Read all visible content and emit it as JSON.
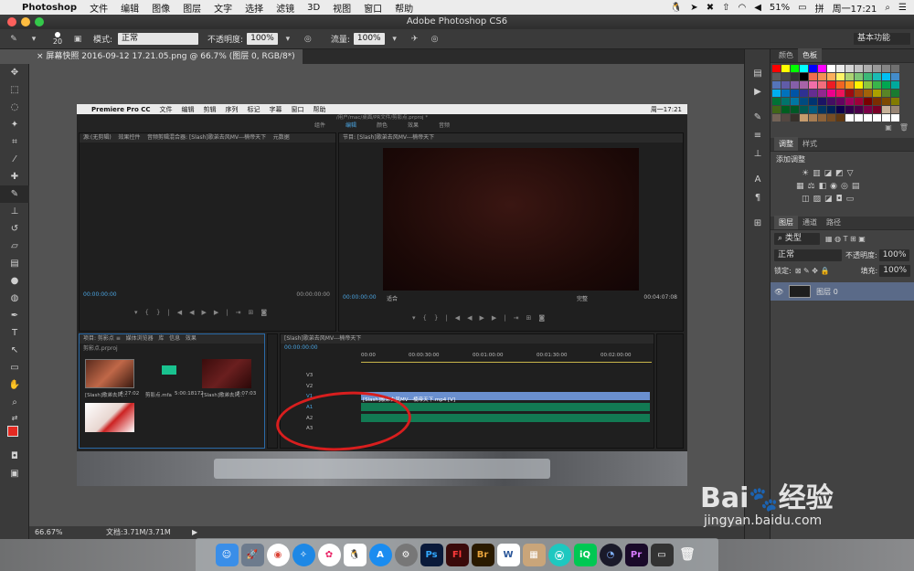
{
  "menubar": {
    "app_name": "Photoshop",
    "items": [
      "文件",
      "编辑",
      "图像",
      "图层",
      "文字",
      "选择",
      "滤镜",
      "3D",
      "视图",
      "窗口",
      "帮助"
    ],
    "battery": "51%",
    "clock": "周一17:21"
  },
  "window": {
    "title": "Adobe Photoshop CS6"
  },
  "options": {
    "brush_size": "20",
    "mode_label": "模式:",
    "mode_value": "正常",
    "opacity_label": "不透明度:",
    "opacity_value": "100%",
    "flow_label": "流量:",
    "flow_value": "100%",
    "workspace": "基本功能"
  },
  "document_tab": {
    "label": "屏幕快照 2016-09-12 17.21.05.png @ 66.7% (图层 0, RGB/8*)",
    "close": "×"
  },
  "status": {
    "zoom": "66.67%",
    "doc_size": "文档:3.71M/3.71M"
  },
  "panels": {
    "color_tabs": [
      "颜色",
      "色板"
    ],
    "adjust_tabs": [
      "调整",
      "样式"
    ],
    "adjust_title": "添加调整",
    "layers_tabs": [
      "图层",
      "通道",
      "路径"
    ],
    "kind_filter": "类型",
    "blend_mode": "正常",
    "opacity_label": "不透明度:",
    "opacity_value": "100%",
    "lock_label": "锁定:",
    "fill_label": "填充:",
    "fill_value": "100%",
    "layer_name": "图层 0"
  },
  "swatch_colors": [
    "#ff0000",
    "#ffff00",
    "#00ff00",
    "#00ffff",
    "#0000ff",
    "#ff00ff",
    "#ffffff",
    "#ebebeb",
    "#d6d6d6",
    "#c2c2c2",
    "#adadad",
    "#999999",
    "#858585",
    "#707070",
    "#5c5c5c",
    "#474747",
    "#333333",
    "#000000",
    "#f26c4f",
    "#f68e55",
    "#fbaf5c",
    "#fff467",
    "#acd372",
    "#7cc576",
    "#3bb878",
    "#1abbb4",
    "#00bff3",
    "#438cca",
    "#5574b9",
    "#605ca8",
    "#855fa8",
    "#a763a8",
    "#f06ea9",
    "#f26d7d",
    "#ed1c24",
    "#f26522",
    "#f7941d",
    "#fff200",
    "#8dc63f",
    "#39b54a",
    "#00a651",
    "#00a99d",
    "#00aeef",
    "#0072bc",
    "#0054a6",
    "#2e3192",
    "#662d91",
    "#92278f",
    "#ec008c",
    "#ed145b",
    "#9e0b0f",
    "#a0410d",
    "#a36209",
    "#aba000",
    "#598527",
    "#1a7b30",
    "#007236",
    "#00746b",
    "#0076a3",
    "#004b80",
    "#003471",
    "#1b1464",
    "#440e62",
    "#630460",
    "#9e005d",
    "#9e0039",
    "#790000",
    "#7b2e00",
    "#7d4900",
    "#827b00",
    "#406618",
    "#005e20",
    "#005826",
    "#005952",
    "#005b7f",
    "#003663",
    "#002157",
    "#0d004c",
    "#32004b",
    "#4b0049",
    "#7b0046",
    "#7a0026",
    "#c7b299",
    "#998675",
    "#736357",
    "#534741",
    "#37302a",
    "#c69c6d",
    "#a67c52",
    "#8c6239",
    "#754c24",
    "#603913",
    "#ffffff",
    "#ffffff",
    "#ffffff",
    "#ffffff",
    "#ffffff",
    "#ffffff"
  ],
  "premiere": {
    "app": "Premiere Pro CC",
    "menus": [
      "文件",
      "编辑",
      "剪辑",
      "序列",
      "标记",
      "字幕",
      "窗口",
      "帮助"
    ],
    "path": "/用户/mac/桌面/PR文件/剪影点.prproj *",
    "workspace_tabs": [
      "组件",
      "编辑",
      "颜色",
      "效果",
      "音频"
    ],
    "source_tabs": [
      "源:(无剪辑)",
      "效果控件",
      "音频剪辑混合器: [Slash]歌弟去风MV---楠帝天下",
      "元数据"
    ],
    "program_tab": "节目: [Slash]歌弟去风MV---楠帝天下",
    "timecode_zero": "00:00:00:00",
    "program_timecode": "00:00:00:00",
    "program_duration": "00:04:07:08",
    "fit": "适合",
    "quality": "完整",
    "project_tabs": [
      "项目: 剪影点 ≡",
      "媒体浏览器",
      "库",
      "信息",
      "效果",
      "标"
    ],
    "project_file": "剪影点.prproj",
    "timeline_tab": "[Slash]歌弟去风MV---楠帝天下",
    "timeline_ticks": [
      "00:00",
      "00:00:30:00",
      "00:01:00:00",
      "00:01:30:00",
      "00:02:00:00"
    ],
    "tracks": [
      "V3",
      "V2",
      "V1",
      "A1",
      "A2",
      "A3"
    ],
    "clip_label": "[Slash]歌弟去风MV---楠帝天下.mp4 [V]",
    "clip_items": [
      {
        "name": "[Slash]歌弟去风...",
        "dur": "4:27:02"
      },
      {
        "name": "剪影点.mfa",
        "dur": "5:00:18172"
      },
      {
        "name": "[Slash]歌弟去风...",
        "dur": "3:07:03"
      }
    ]
  },
  "watermark": {
    "brand": "Bai",
    "brand2": "经验",
    "url": "jingyan.baidu.com"
  }
}
